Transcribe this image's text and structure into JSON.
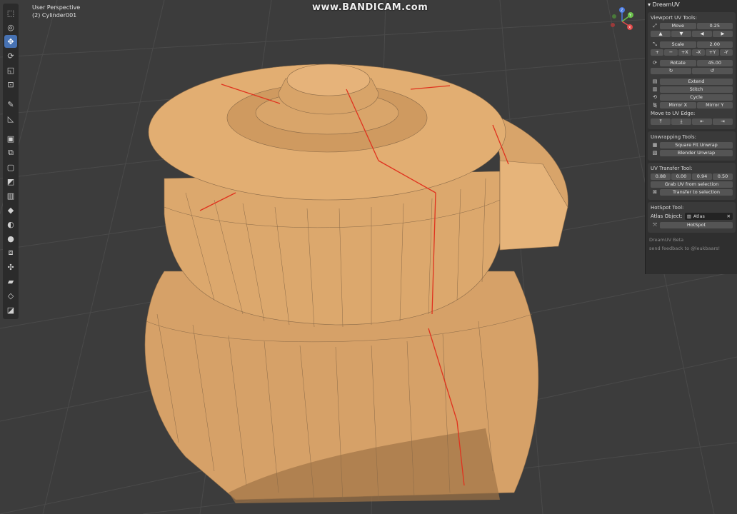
{
  "viewport": {
    "mode": "User Perspective",
    "object": "(2) Cylinder001"
  },
  "watermark": "www.BANDICAM.com",
  "toolbar": {
    "tools": [
      "select-box-icon",
      "cursor-icon",
      "move-icon",
      "rotate-icon",
      "scale-icon",
      "transform-icon",
      "annotate-icon",
      "measure-icon",
      "add-cube-icon",
      "extrude-icon",
      "inset-icon",
      "bevel-icon",
      "loop-cut-icon",
      "knife-icon",
      "poly-build-icon",
      "spin-icon",
      "smooth-icon",
      "edge-slide-icon",
      "shrink-fatten-icon",
      "shear-icon",
      "rip-region-icon"
    ],
    "active_index": 2
  },
  "gizmo": {
    "x_label": "X",
    "y_label": "Y",
    "z_label": "Z"
  },
  "panel": {
    "title": "DreamUV",
    "viewport_tools": {
      "title": "Viewport UV Tools:",
      "move_label": "Move",
      "move_value": "0.25",
      "move_arrows": [
        "▲",
        "▼",
        "◀",
        "▶"
      ],
      "scale_label": "Scale",
      "scale_value": "2.00",
      "scale_buttons": [
        "+",
        "−",
        "+X",
        "-X",
        "+Y",
        "-Y"
      ],
      "rotate_label": "Rotate",
      "rotate_value": "45.00",
      "extend": "Extend",
      "stitch": "Stitch",
      "cycle": "Cycle",
      "mirror_x": "Mirror X",
      "mirror_y": "Mirror Y",
      "move_to_edge": "Move to UV Edge:",
      "edge_buttons": [
        "⤒",
        "⤓",
        "⇤",
        "⇥"
      ]
    },
    "unwrap": {
      "title": "Unwrapping Tools:",
      "square_fit": "Square Fit Unwrap",
      "blender_unwrap": "Blender Unwrap"
    },
    "transfer": {
      "title": "UV Transfer Tool:",
      "values": [
        "0.88",
        "0.00",
        "0.94",
        "0.50"
      ],
      "grab": "Grab UV from selection",
      "transfer": "Transfer to selection"
    },
    "hotspot": {
      "title": "HotSpot Tool:",
      "atlas_label": "Atlas Object:",
      "atlas_value": "Atlas",
      "button": "HotSpot"
    },
    "footer": {
      "line1": "DreamUV Beta",
      "line2": "send feedback to @leukbaars!"
    }
  },
  "colors": {
    "mesh": "#d9a46a",
    "mesh_dark": "#c48f57",
    "seam": "#e0321e",
    "grid_line": "#4a4a4a",
    "active_tool": "#4772b3"
  }
}
